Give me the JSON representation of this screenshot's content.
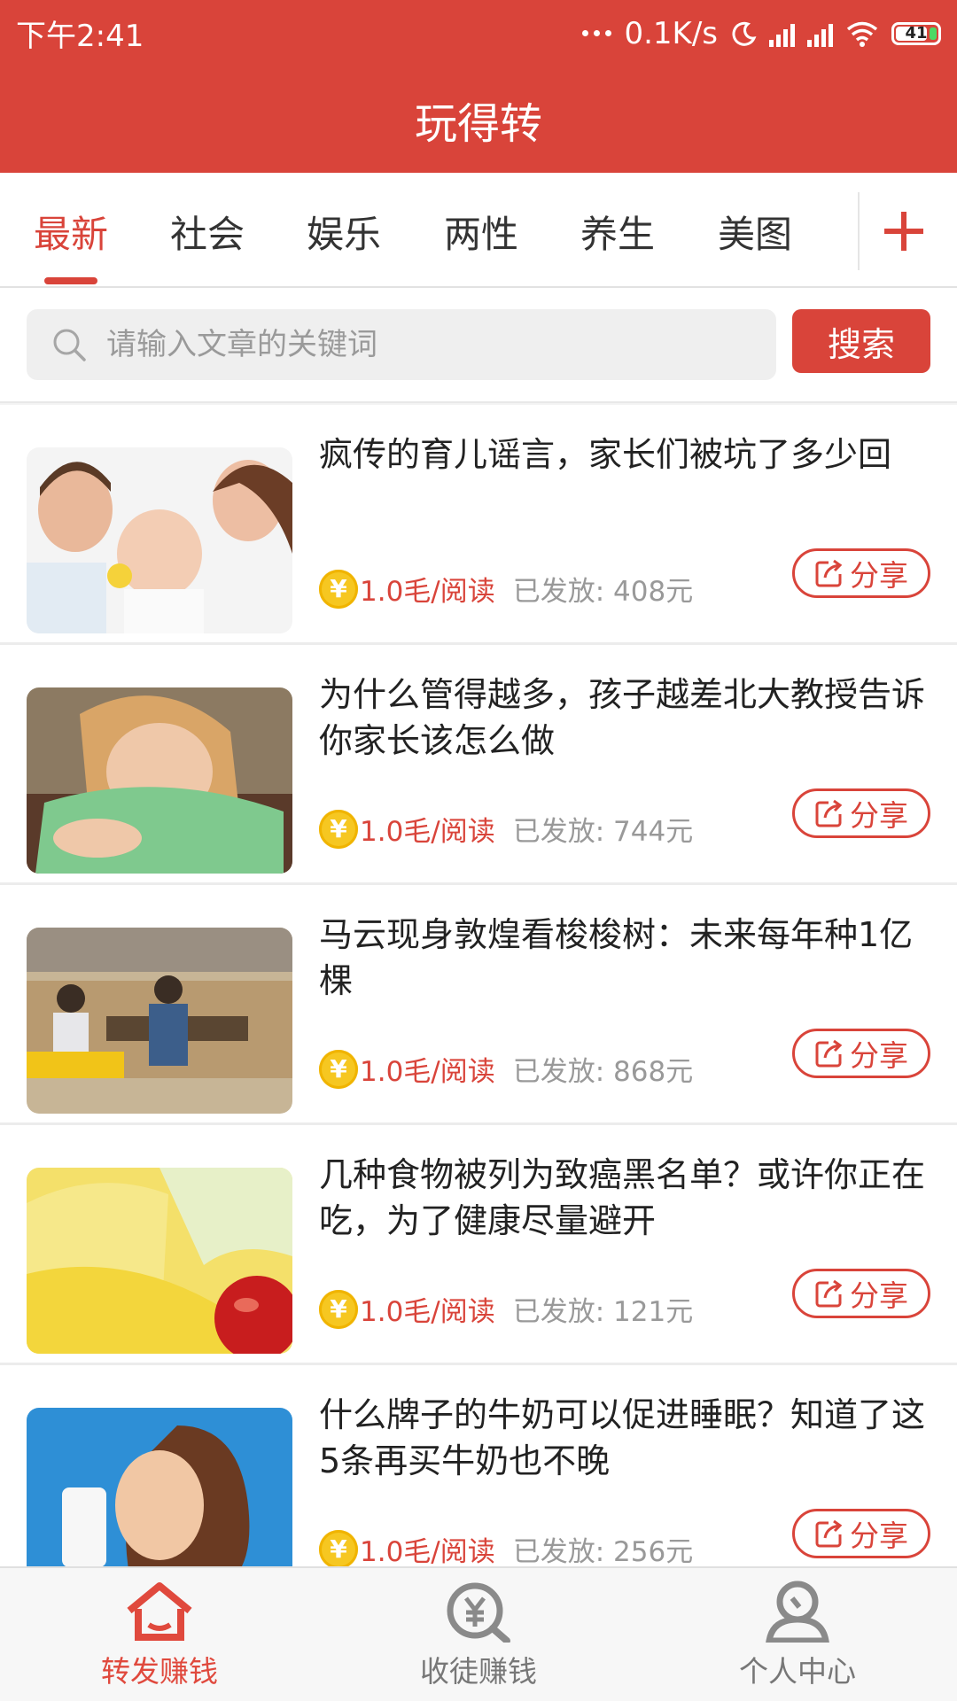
{
  "status_bar": {
    "time": "下午2:41",
    "network_speed": "0.1K/s",
    "battery": "41"
  },
  "header": {
    "title": "玩得转"
  },
  "tabs": [
    {
      "label": "最新",
      "active": true
    },
    {
      "label": "社会",
      "active": false
    },
    {
      "label": "娱乐",
      "active": false
    },
    {
      "label": "两性",
      "active": false
    },
    {
      "label": "养生",
      "active": false
    },
    {
      "label": "美图",
      "active": false
    }
  ],
  "search": {
    "placeholder": "请输入文章的关键词",
    "button_label": "搜索"
  },
  "articles": [
    {
      "title": "疯传的育儿谣言，家长们被坑了多少回",
      "rate": "1.0毛/阅读",
      "paid": "已发放: 408元",
      "share_label": "分享"
    },
    {
      "title": "为什么管得越多，孩子越差北大教授告诉你家长该怎么做",
      "rate": "1.0毛/阅读",
      "paid": "已发放: 744元",
      "share_label": "分享"
    },
    {
      "title": "马云现身敦煌看梭梭树：未来每年种1亿棵",
      "rate": "1.0毛/阅读",
      "paid": "已发放: 868元",
      "share_label": "分享"
    },
    {
      "title": "几种食物被列为致癌黑名单？或许你正在吃，为了健康尽量避开",
      "rate": "1.0毛/阅读",
      "paid": "已发放: 121元",
      "share_label": "分享"
    },
    {
      "title": "什么牌子的牛奶可以促进睡眠？知道了这5条再买牛奶也不晚",
      "rate": "1.0毛/阅读",
      "paid": "已发放: 256元",
      "share_label": "分享"
    }
  ],
  "coin_symbol": "¥",
  "bottom_nav": [
    {
      "label": "转发赚钱",
      "icon": "home-icon",
      "active": true
    },
    {
      "label": "收徒赚钱",
      "icon": "money-search-icon",
      "active": false
    },
    {
      "label": "个人中心",
      "icon": "person-icon",
      "active": false
    }
  ],
  "colors": {
    "brand": "#d9443a",
    "coin": "#f6c721"
  }
}
